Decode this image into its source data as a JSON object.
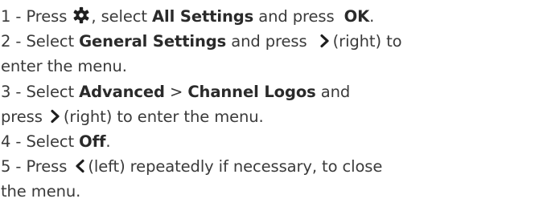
{
  "steps": [
    {
      "num": "1 -",
      "verb": "Press",
      "icon": "gear-icon",
      "after_icon": ", select",
      "bold1": "All Settings",
      "mid": "and press",
      "bold2": "OK",
      "end": "."
    },
    {
      "num": "2 -",
      "verb": "Select",
      "bold1": "General Settings",
      "mid": "and press",
      "icon": "chevron-right-icon",
      "tail": "(right) to",
      "continuation": "enter the menu."
    },
    {
      "num": "3 -",
      "verb": "Select",
      "bold1": "Advanced",
      "sep": ">",
      "bold2": "Channel Logos",
      "tail": "and",
      "continuation_verb": "press",
      "icon": "chevron-right-icon",
      "continuation": "(right) to enter the menu."
    },
    {
      "num": "4 -",
      "verb": "Select",
      "bold1": "Off",
      "end": "."
    },
    {
      "num": "5 -",
      "verb": "Press",
      "icon": "chevron-left-icon",
      "tail": "(left) repeatedly if necessary, to close",
      "continuation": "the menu."
    }
  ]
}
